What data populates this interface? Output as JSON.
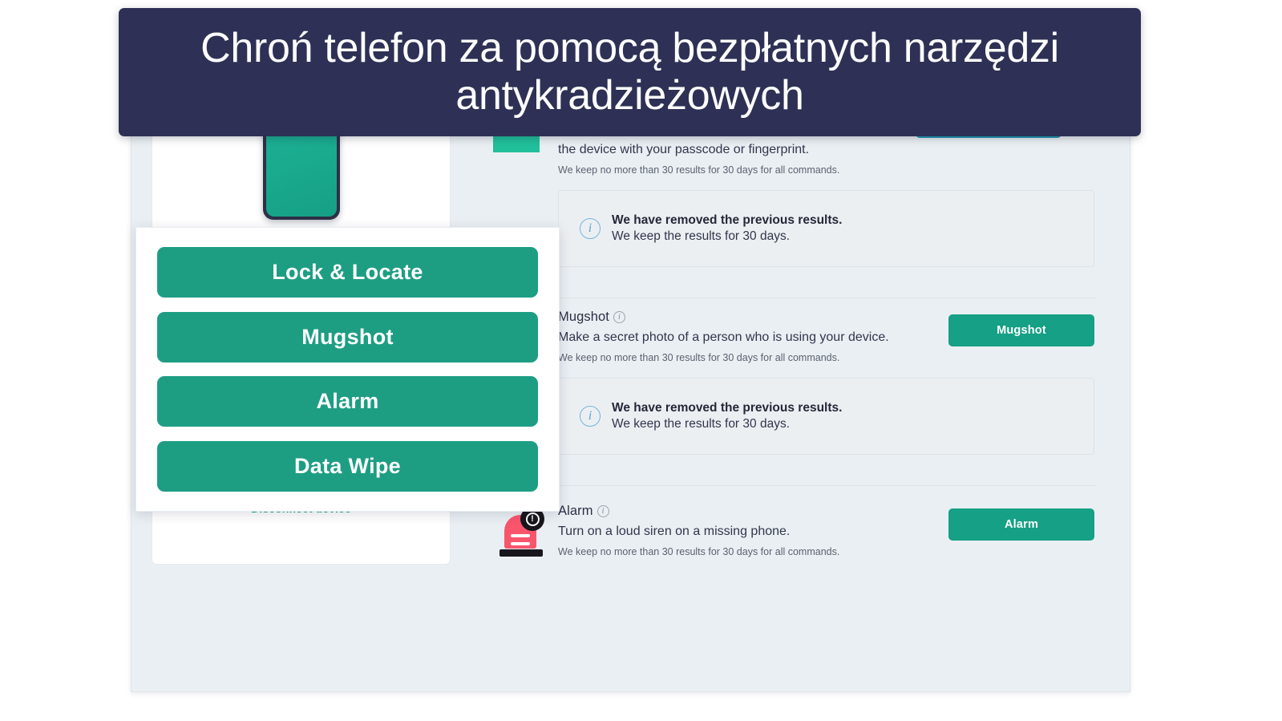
{
  "banner": {
    "text": "Chroń telefon za pomocą bezpłatnych narzędzi antykradzieżowych",
    "bg_color": "#2e3155"
  },
  "theme": {
    "accent_green": "#16a085",
    "panel_green": "#1d9e83",
    "container_bg": "#eaeff3",
    "siren_red": "#f9556d",
    "info_blue": "#5aa3d4"
  },
  "device_card": {
    "phone_status_icon": "checkmark-icon",
    "disconnect_label": "Disconnect device"
  },
  "overlay_panel": {
    "buttons": [
      {
        "label": "Lock & Locate"
      },
      {
        "label": "Mugshot"
      },
      {
        "label": "Alarm"
      },
      {
        "label": "Data Wipe"
      }
    ]
  },
  "features": [
    {
      "id": "lock-locate",
      "title": "",
      "desc": "the device with your passcode or fingerprint.",
      "note": "We keep no more than 30 results for 30 days for all commands.",
      "button_label": "",
      "icon": "lock-icon",
      "result": {
        "strong": "We have removed the previous results.",
        "sub": "We keep the results for 30 days."
      }
    },
    {
      "id": "mugshot",
      "title": "Mugshot",
      "desc": "Make a secret photo of a person who is using your device.",
      "note": "We keep no more than 30 results for 30 days for all commands.",
      "button_label": "Mugshot",
      "icon": "camera-icon",
      "result": {
        "strong": "We have removed the previous results.",
        "sub": "We keep the results for 30 days."
      }
    },
    {
      "id": "alarm",
      "title": "Alarm",
      "desc": "Turn on a loud siren on a missing phone.",
      "note": "We keep no more than 30 results for 30 days for all commands.",
      "button_label": "Alarm",
      "icon": "siren-icon"
    }
  ]
}
